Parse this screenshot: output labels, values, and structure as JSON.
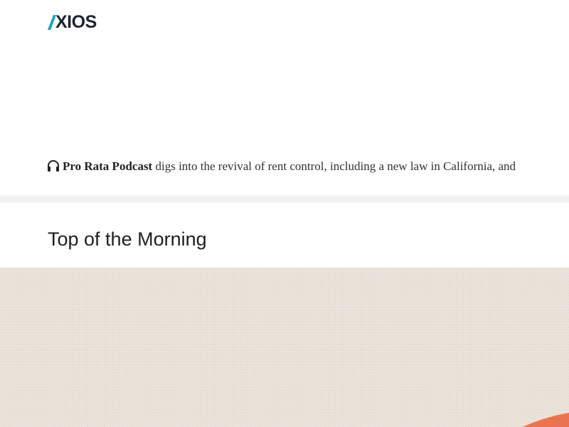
{
  "header": {
    "logo_text": "XIOS",
    "logo_full": "AXIOS",
    "logo_mark_color": "#1aa0c8",
    "logo_text_color": "#1b2432"
  },
  "podcast": {
    "icon": "headphones-icon",
    "name": "Pro Rata Podcast",
    "text": " digs into the revival of rent control, including a new law in California, and"
  },
  "section": {
    "title": "Top of the Morning"
  },
  "illustration": {
    "background_color": "#e9e1d8",
    "accent_color": "#e8754f"
  }
}
